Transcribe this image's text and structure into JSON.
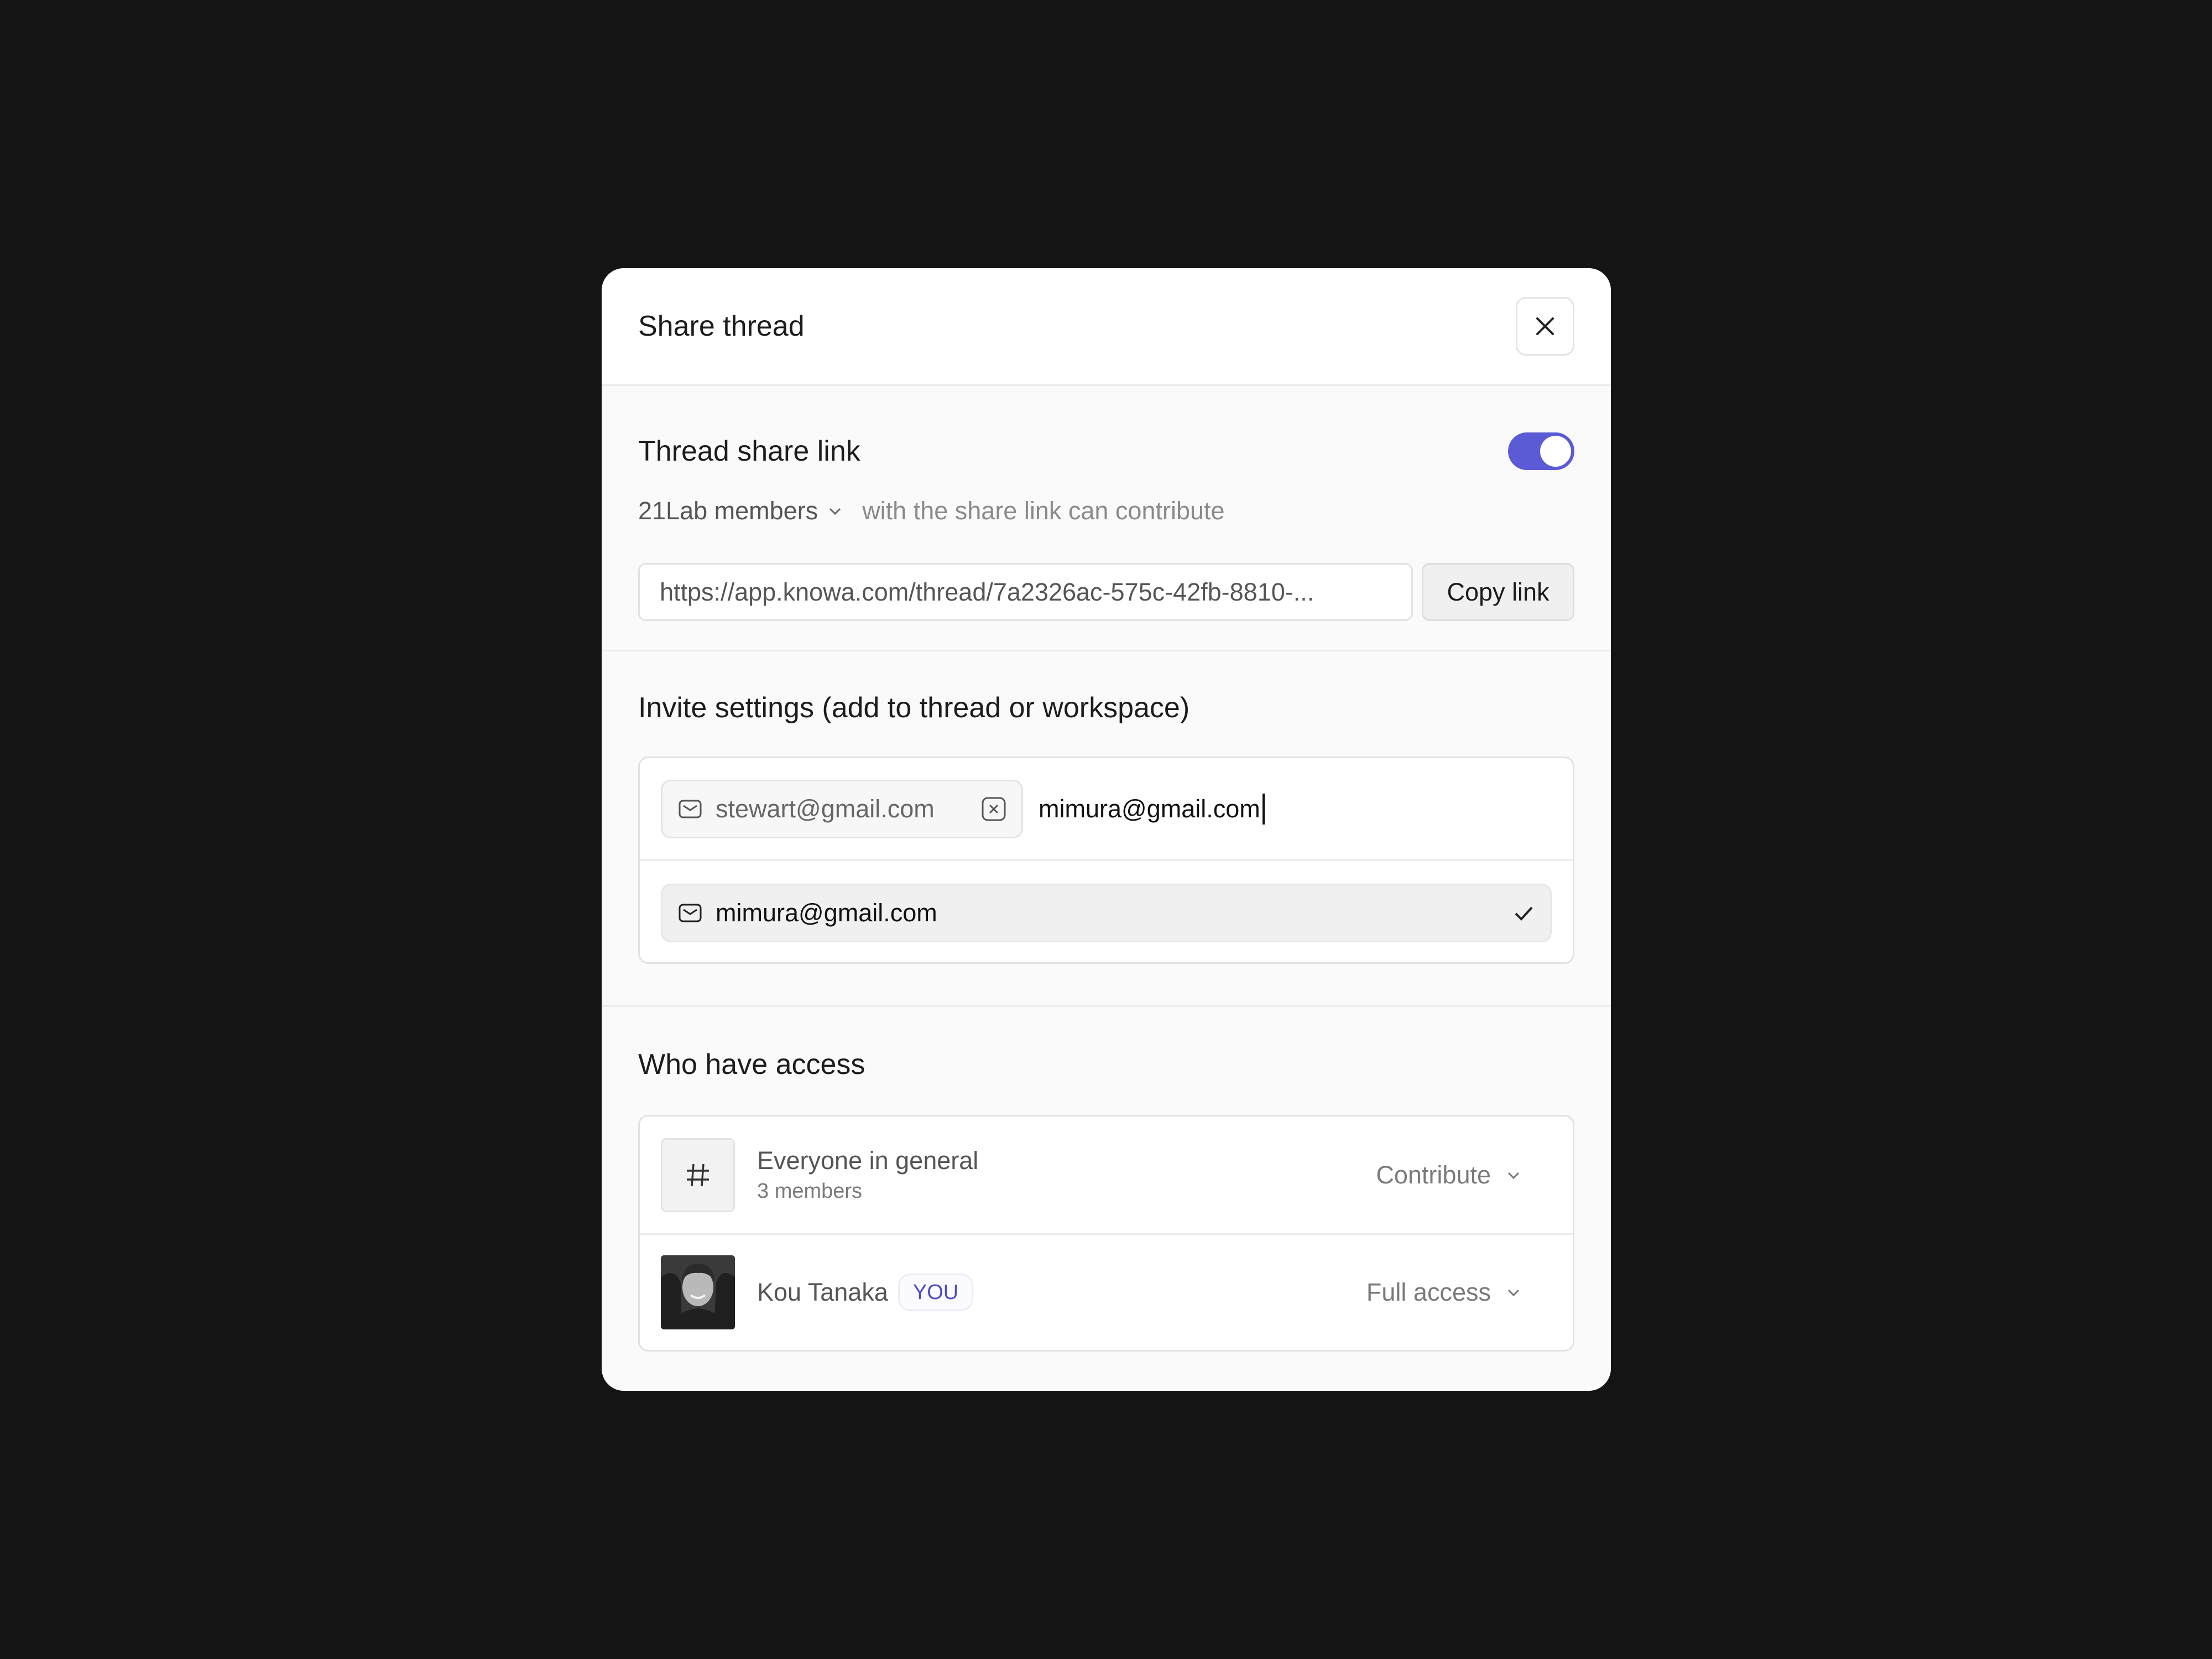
{
  "modal": {
    "title": "Share thread",
    "close_icon": "close-icon"
  },
  "share_link": {
    "title": "Thread share link",
    "toggle_on": true,
    "toggle_color": "#5b5bd6",
    "scope": "21Lab members",
    "scope_suffix": "with the share link can contribute",
    "url": "https://app.knowa.com/thread/7a2326ac-575c-42fb-8810-...",
    "copy_label": "Copy link"
  },
  "invite": {
    "title": "Invite settings (add to thread or workspace)",
    "chip_email": "stewart@gmail.com",
    "typed_value": "mimura@gmail.com",
    "suggestion_email": "mimura@gmail.com"
  },
  "access": {
    "title": "Who have access",
    "rows": [
      {
        "name": "Everyone in general",
        "sub": "3 members",
        "permission": "Contribute",
        "icon": "hash-icon"
      },
      {
        "name": "Kou Tanaka",
        "badge": "YOU",
        "permission": "Full access",
        "icon": "avatar"
      }
    ]
  }
}
